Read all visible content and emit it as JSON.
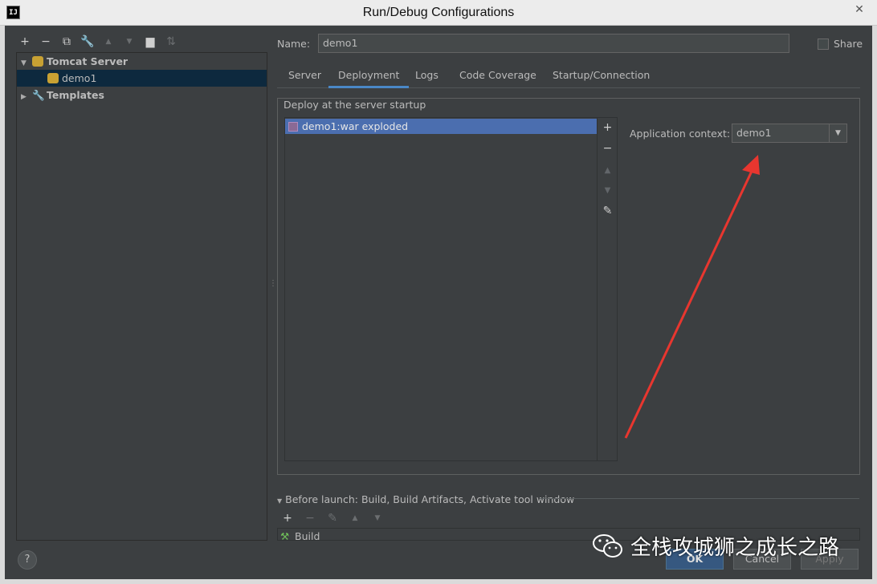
{
  "window": {
    "title": "Run/Debug Configurations",
    "app_icon": "IJ"
  },
  "tree_toolbar": {
    "add": "+",
    "remove": "−",
    "copy_icon": "copy-icon",
    "wrench_icon": "wrench-icon",
    "up": "▲",
    "down": "▼",
    "folder_icon": "folder-icon",
    "sort_icon": "sort-icon"
  },
  "tree": {
    "tomcat": {
      "label": "Tomcat Server"
    },
    "demo1": {
      "label": "demo1"
    },
    "templates": {
      "label": "Templates"
    }
  },
  "form": {
    "name_label": "Name:",
    "name_value": "demo1",
    "share_label": "Share"
  },
  "tabs": [
    {
      "label": "Server"
    },
    {
      "label": "Deployment"
    },
    {
      "label": "Logs"
    },
    {
      "label": "Code Coverage"
    },
    {
      "label": "Startup/Connection"
    }
  ],
  "deployment": {
    "group_title": "Deploy at the server startup",
    "artifact": "demo1:war exploded",
    "context_label": "Application context:",
    "context_value": "demo1"
  },
  "before_launch": {
    "label": "Before launch: Build, Build Artifacts, Activate tool window",
    "item": "Build"
  },
  "buttons": {
    "help": "?",
    "ok": "OK",
    "cancel": "Cancel",
    "apply": "Apply"
  },
  "watermark": {
    "text": "全栈攻城狮之成长之路"
  },
  "colors": {
    "accent": "#4a88c7",
    "selection": "#4b6eaf",
    "annotation": "#e8362f"
  }
}
